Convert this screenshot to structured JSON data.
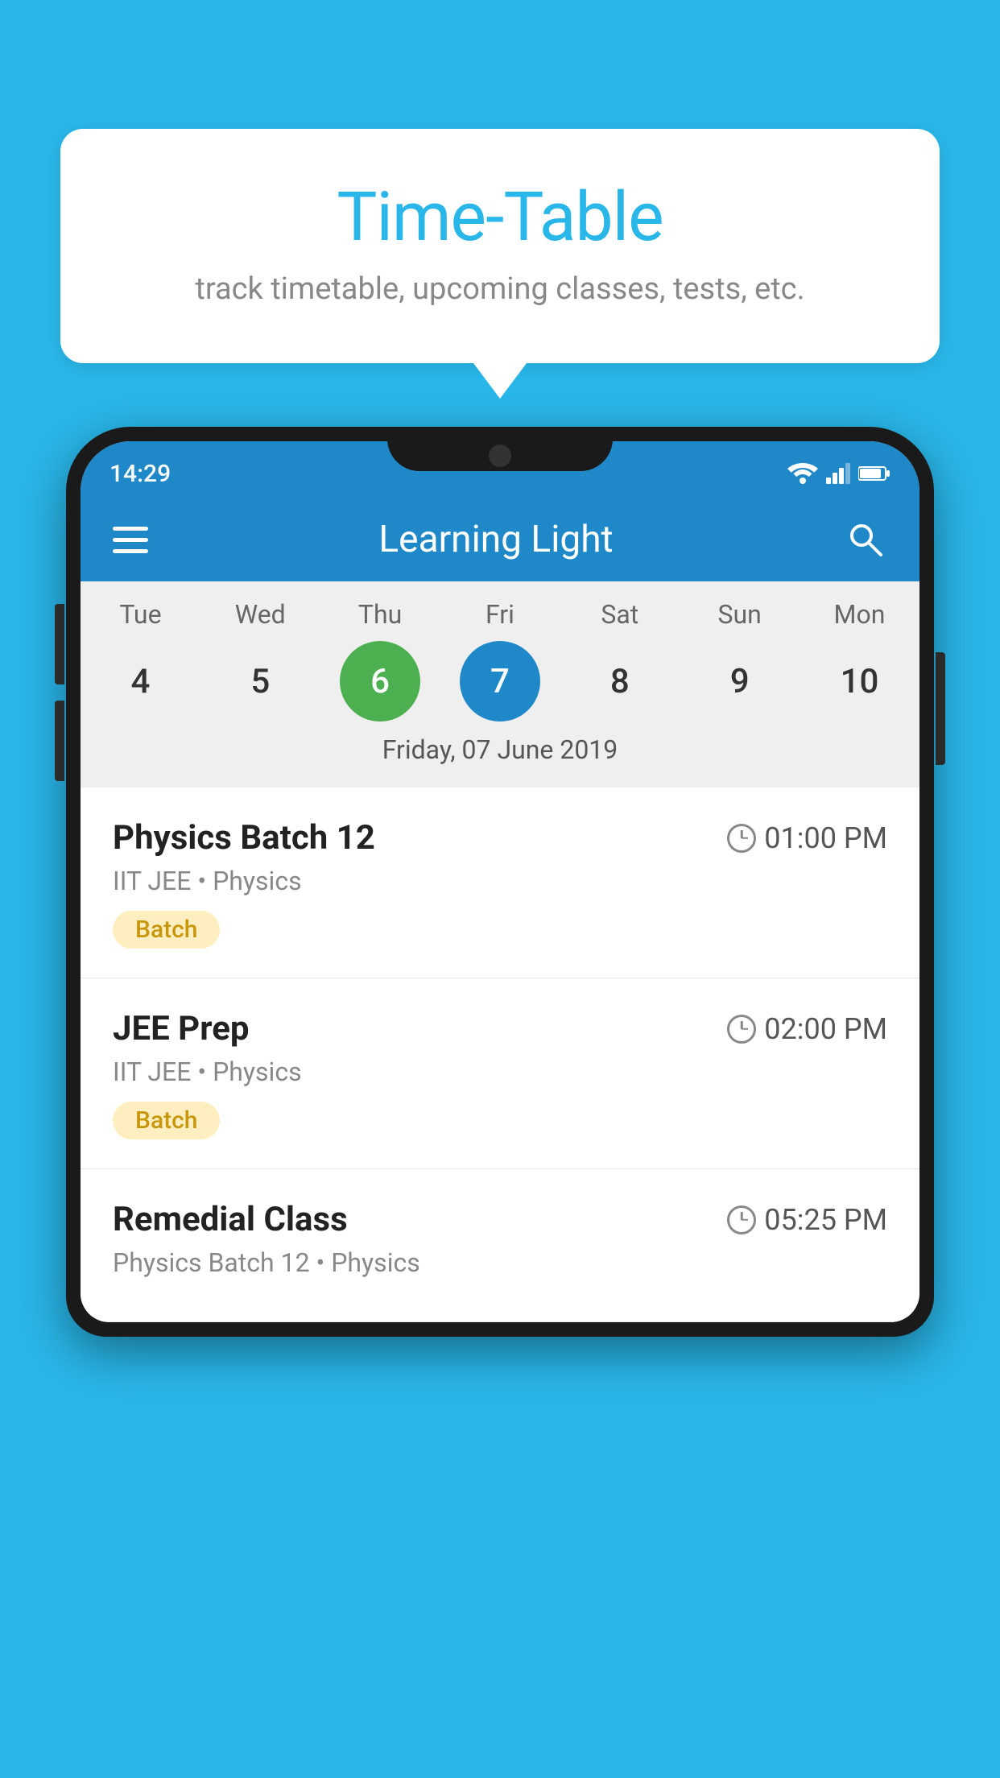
{
  "background": "#29b6e8",
  "tooltip": {
    "title": "Time-Table",
    "subtitle": "track timetable, upcoming classes, tests, etc."
  },
  "statusBar": {
    "time": "14:29",
    "icons": [
      "wifi",
      "signal",
      "battery"
    ]
  },
  "appHeader": {
    "title": "Learning Light",
    "searchLabel": "search"
  },
  "calendar": {
    "days": [
      "Tue",
      "Wed",
      "Thu",
      "Fri",
      "Sat",
      "Sun",
      "Mon"
    ],
    "dates": [
      "4",
      "5",
      "6",
      "7",
      "8",
      "9",
      "10"
    ],
    "todayIndex": 2,
    "selectedIndex": 3,
    "selectedLabel": "Friday, 07 June 2019"
  },
  "classes": [
    {
      "name": "Physics Batch 12",
      "time": "01:00 PM",
      "meta": "IIT JEE • Physics",
      "badge": "Batch"
    },
    {
      "name": "JEE Prep",
      "time": "02:00 PM",
      "meta": "IIT JEE • Physics",
      "badge": "Batch"
    },
    {
      "name": "Remedial Class",
      "time": "05:25 PM",
      "meta": "Physics Batch 12 • Physics",
      "badge": ""
    }
  ]
}
